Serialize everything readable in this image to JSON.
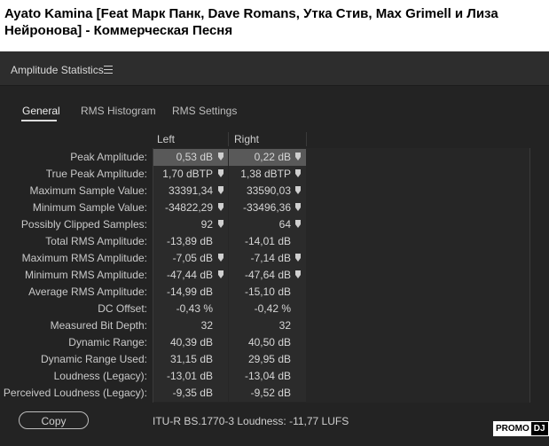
{
  "page_title": "Ayato Kamina [Feat Марк Панк, Dave Romans, Утка Стив, Max Grimell и Лиза Нейронова] - Коммерческая Песня",
  "panel": {
    "title": "Amplitude Statistics",
    "menu_icon": "hamburger-menu-icon"
  },
  "tabs": [
    {
      "label": "General",
      "active": true
    },
    {
      "label": "RMS Histogram",
      "active": false
    },
    {
      "label": "RMS Settings",
      "active": false
    }
  ],
  "columns": {
    "left": "Left",
    "right": "Right"
  },
  "rows": [
    {
      "label": "Peak Amplitude:",
      "left": "0,53 dB",
      "right": "0,22 dB",
      "left_marker": true,
      "right_marker": true,
      "selected": true
    },
    {
      "label": "True Peak Amplitude:",
      "left": "1,70 dBTP",
      "right": "1,38 dBTP",
      "left_marker": true,
      "right_marker": true
    },
    {
      "label": "Maximum Sample Value:",
      "left": "33391,34",
      "right": "33590,03",
      "left_marker": true,
      "right_marker": true
    },
    {
      "label": "Minimum Sample Value:",
      "left": "-34822,29",
      "right": "-33496,36",
      "left_marker": true,
      "right_marker": true
    },
    {
      "label": "Possibly Clipped Samples:",
      "left": "92",
      "right": "64",
      "left_marker": true,
      "right_marker": true
    },
    {
      "label": "Total RMS Amplitude:",
      "left": "-13,89 dB",
      "right": "-14,01 dB",
      "left_marker": false,
      "right_marker": false
    },
    {
      "label": "Maximum RMS Amplitude:",
      "left": "-7,05 dB",
      "right": "-7,14 dB",
      "left_marker": true,
      "right_marker": true
    },
    {
      "label": "Minimum RMS Amplitude:",
      "left": "-47,44 dB",
      "right": "-47,64 dB",
      "left_marker": true,
      "right_marker": true
    },
    {
      "label": "Average RMS Amplitude:",
      "left": "-14,99 dB",
      "right": "-15,10 dB",
      "left_marker": false,
      "right_marker": false
    },
    {
      "label": "DC Offset:",
      "left": "-0,43 %",
      "right": "-0,42 %",
      "left_marker": false,
      "right_marker": false
    },
    {
      "label": "Measured Bit Depth:",
      "left": "32",
      "right": "32",
      "left_marker": false,
      "right_marker": false
    },
    {
      "label": "Dynamic Range:",
      "left": "40,39 dB",
      "right": "40,50 dB",
      "left_marker": false,
      "right_marker": false
    },
    {
      "label": "Dynamic Range Used:",
      "left": "31,15 dB",
      "right": "29,95 dB",
      "left_marker": false,
      "right_marker": false
    },
    {
      "label": "Loudness (Legacy):",
      "left": "-13,01 dB",
      "right": "-13,04 dB",
      "left_marker": false,
      "right_marker": false
    },
    {
      "label": "Perceived Loudness (Legacy):",
      "left": "-9,35 dB",
      "right": "-9,52 dB",
      "left_marker": false,
      "right_marker": false
    }
  ],
  "footer": {
    "copy_label": "Copy",
    "loudness_text": "ITU-R BS.1770-3 Loudness:  -11,77 LUFS"
  },
  "watermark": {
    "part1": "PROMO",
    "part2": "DJ"
  },
  "colors": {
    "panel_bg": "#232323",
    "selected_row": "#595959",
    "text": "#d4d4d4"
  }
}
